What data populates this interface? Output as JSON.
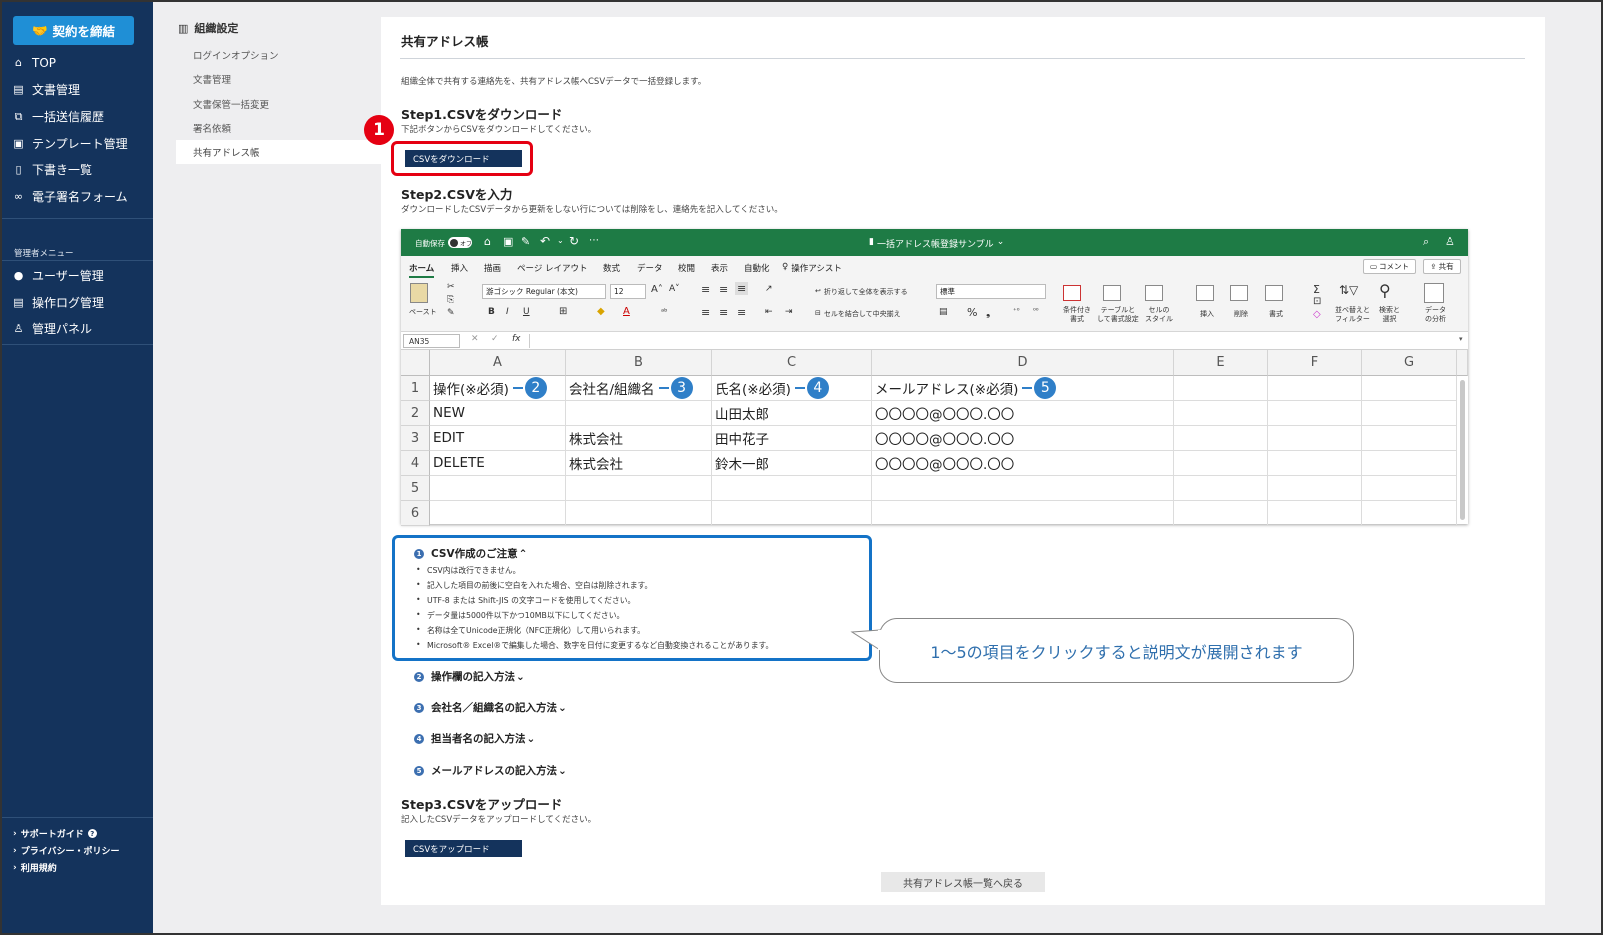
{
  "sidebar": {
    "sign_button": "契約を締結",
    "items": [
      {
        "label": "TOP",
        "icon": "home-icon"
      },
      {
        "label": "文書管理",
        "icon": "document-icon"
      },
      {
        "label": "一括送信履歴",
        "icon": "batch-send-icon"
      },
      {
        "label": "テンプレート管理",
        "icon": "template-icon"
      },
      {
        "label": "下書き一覧",
        "icon": "draft-icon"
      },
      {
        "label": "電子署名フォーム",
        "icon": "link-icon"
      }
    ],
    "admin_title": "管理者メニュー",
    "admin_items": [
      {
        "label": "ユーザー管理",
        "icon": "user-icon"
      },
      {
        "label": "操作ログ管理",
        "icon": "log-icon"
      },
      {
        "label": "管理パネル",
        "icon": "admin-panel-icon"
      }
    ],
    "footer": [
      {
        "label": "サポートガイド"
      },
      {
        "label": "プライバシー・ポリシー"
      },
      {
        "label": "利用規約"
      }
    ]
  },
  "settings_menu": {
    "title": "組織設定",
    "items": [
      "ログインオプション",
      "文書管理",
      "文書保管一括変更",
      "署名依頼",
      "共有アドレス帳"
    ],
    "active_index": 4
  },
  "main": {
    "title": "共有アドレス帳",
    "description": "組織全体で共有する連絡先を、共有アドレス帳へCSVデータで一括登録します。",
    "step1": {
      "title": "Step1.CSVをダウンロード",
      "desc": "下記ボタンからCSVをダウンロードしてください。",
      "button": "CSVをダウンロード",
      "callout": "1"
    },
    "step2": {
      "title": "Step2.CSVを入力",
      "desc": "ダウンロードしたCSVデータから更新をしない行については削除をし、連絡先を記入してください。"
    },
    "step3": {
      "title": "Step3.CSVをアップロード",
      "desc": "記入したCSVデータをアップロードしてください。",
      "button": "CSVをアップロード"
    },
    "back_button": "共有アドレス帳一覧へ戻る"
  },
  "excel": {
    "autosave": "自動保存",
    "autosave_state": "オフ",
    "filename": "一括アドレス帳登録サンプル",
    "tabs": [
      "ホーム",
      "挿入",
      "描画",
      "ページ レイアウト",
      "数式",
      "データ",
      "校閲",
      "表示",
      "自動化",
      "操作アシスト"
    ],
    "comment_btn": "コメント",
    "share_btn": "共有",
    "font_name": "游ゴシック Regular (本文)",
    "font_size": "12",
    "number_format": "標準",
    "ribbon_labels": {
      "paste": "ペースト",
      "wrap": "折り返して全体を表示する",
      "merge": "セルを結合して中央揃え",
      "cond": [
        "条件付き",
        "書式"
      ],
      "table": [
        "テーブルと",
        "して書式設定"
      ],
      "style": [
        "セルの",
        "スタイル"
      ],
      "insert": "挿入",
      "delete": "削除",
      "format": "書式",
      "sort": [
        "並べ替えと",
        "フィルター"
      ],
      "find": [
        "検索と",
        "選択"
      ],
      "analyze": [
        "データ",
        "の分析"
      ]
    },
    "name_box": "AN35",
    "fx": "fx",
    "columns": [
      "A",
      "B",
      "C",
      "D",
      "E",
      "F",
      "G"
    ],
    "rows": [
      "1",
      "2",
      "3",
      "4",
      "5",
      "6"
    ],
    "header_row": [
      "操作(※必須)",
      "会社名/組織名",
      "氏名(※必須)",
      "メールアドレス(※必須)"
    ],
    "header_callouts": [
      "2",
      "3",
      "4",
      "5"
    ],
    "data_rows": [
      [
        "NEW",
        "",
        "山田太郎",
        "〇〇〇〇@〇〇〇.〇〇"
      ],
      [
        "EDIT",
        "株式会社",
        "田中花子",
        "〇〇〇〇@〇〇〇.〇〇"
      ],
      [
        "DELETE",
        "株式会社",
        "鈴木一郎",
        "〇〇〇〇@〇〇〇.〇〇"
      ]
    ]
  },
  "notes": {
    "sections": [
      {
        "num": "1",
        "title": "CSV作成のご注意",
        "expanded": true
      },
      {
        "num": "2",
        "title": "操作欄の記入方法",
        "expanded": false
      },
      {
        "num": "3",
        "title": "会社名／組織名の記入方法",
        "expanded": false
      },
      {
        "num": "4",
        "title": "担当者名の記入方法",
        "expanded": false
      },
      {
        "num": "5",
        "title": "メールアドレスの記入方法",
        "expanded": false
      }
    ],
    "bullets": [
      "CSV内は改行できません。",
      "記入した項目の前後に空白を入れた場合、空白は削除されます。",
      "UTF-8 または Shift-JIS の文字コードを使用してください。",
      "データ量は5000件以下かつ10MB以下にしてください。",
      "名称は全てUnicode正規化（NFC正規化）して用いられます。",
      "Microsoft® Excel®で編集した場合、数字を日付に変更するなど自動変換されることがあります。"
    ],
    "bubble": "1～5の項目をクリックすると説明文が展開されます"
  },
  "colors": {
    "sidebar": "#14335c",
    "accent": "#1f8fd6",
    "excel_green": "#1e7b45",
    "callout_red": "#e50012",
    "callout_blue": "#2f7fc8"
  }
}
